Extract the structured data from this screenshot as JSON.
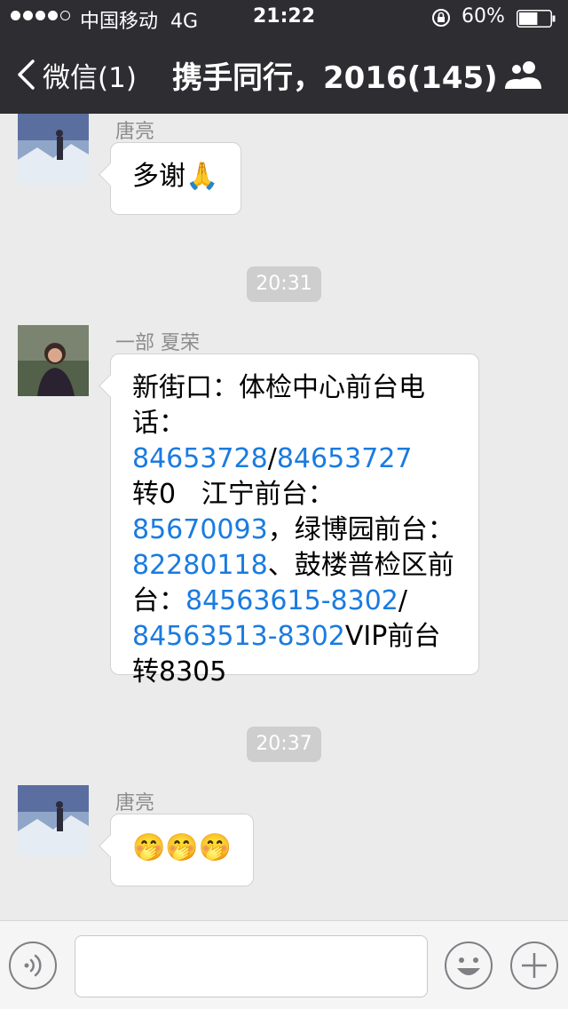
{
  "status_bar": {
    "carrier": "中国移动",
    "network": "4G",
    "time": "21:22",
    "battery": "60%",
    "battery_level": 0.6
  },
  "nav": {
    "back_label": "微信(1)",
    "title": "携手同行，2016(145)"
  },
  "messages": [
    {
      "sender": "唐亮",
      "text": "多谢🙏"
    },
    {
      "timestamp": "20:31"
    },
    {
      "sender": "一部 夏荣",
      "lines": [
        [
          "新街口：体检中心前台电"
        ],
        [
          "话：",
          "84653728",
          "/",
          "84653727"
        ],
        [
          "转0   江宁前台："
        ],
        [
          "85670093",
          "，绿博园前台："
        ],
        [
          "82280118",
          "、鼓楼普检区前"
        ],
        [
          "台：",
          "84563615-8302",
          "/"
        ],
        [
          "84563513-8302",
          "VIP前台"
        ],
        [
          "转8305"
        ]
      ]
    },
    {
      "timestamp": "20:37"
    },
    {
      "sender": "唐亮",
      "text": "🤭🤭🤭"
    }
  ],
  "colors": {
    "nav_bg": "#2d2d32",
    "chat_bg": "#ebebeb",
    "link": "#1a7be0"
  },
  "icons": {
    "back": "chevron-left-icon",
    "group": "people-icon",
    "voice": "voice-icon",
    "emoji": "smiley-icon",
    "more": "plus-icon"
  }
}
